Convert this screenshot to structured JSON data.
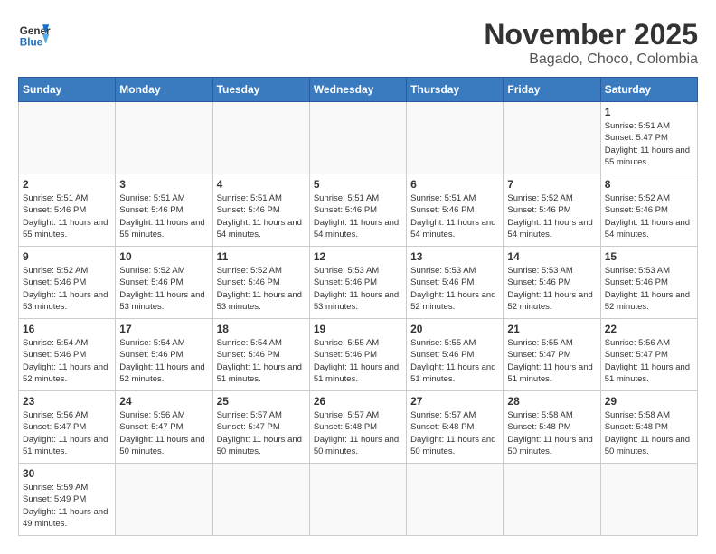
{
  "header": {
    "logo_general": "General",
    "logo_blue": "Blue",
    "month_title": "November 2025",
    "location": "Bagado, Choco, Colombia"
  },
  "weekdays": [
    "Sunday",
    "Monday",
    "Tuesday",
    "Wednesday",
    "Thursday",
    "Friday",
    "Saturday"
  ],
  "weeks": [
    [
      {
        "day": "",
        "info": ""
      },
      {
        "day": "",
        "info": ""
      },
      {
        "day": "",
        "info": ""
      },
      {
        "day": "",
        "info": ""
      },
      {
        "day": "",
        "info": ""
      },
      {
        "day": "",
        "info": ""
      },
      {
        "day": "1",
        "info": "Sunrise: 5:51 AM\nSunset: 5:47 PM\nDaylight: 11 hours and 55 minutes."
      }
    ],
    [
      {
        "day": "2",
        "info": "Sunrise: 5:51 AM\nSunset: 5:46 PM\nDaylight: 11 hours and 55 minutes."
      },
      {
        "day": "3",
        "info": "Sunrise: 5:51 AM\nSunset: 5:46 PM\nDaylight: 11 hours and 55 minutes."
      },
      {
        "day": "4",
        "info": "Sunrise: 5:51 AM\nSunset: 5:46 PM\nDaylight: 11 hours and 54 minutes."
      },
      {
        "day": "5",
        "info": "Sunrise: 5:51 AM\nSunset: 5:46 PM\nDaylight: 11 hours and 54 minutes."
      },
      {
        "day": "6",
        "info": "Sunrise: 5:51 AM\nSunset: 5:46 PM\nDaylight: 11 hours and 54 minutes."
      },
      {
        "day": "7",
        "info": "Sunrise: 5:52 AM\nSunset: 5:46 PM\nDaylight: 11 hours and 54 minutes."
      },
      {
        "day": "8",
        "info": "Sunrise: 5:52 AM\nSunset: 5:46 PM\nDaylight: 11 hours and 54 minutes."
      }
    ],
    [
      {
        "day": "9",
        "info": "Sunrise: 5:52 AM\nSunset: 5:46 PM\nDaylight: 11 hours and 53 minutes."
      },
      {
        "day": "10",
        "info": "Sunrise: 5:52 AM\nSunset: 5:46 PM\nDaylight: 11 hours and 53 minutes."
      },
      {
        "day": "11",
        "info": "Sunrise: 5:52 AM\nSunset: 5:46 PM\nDaylight: 11 hours and 53 minutes."
      },
      {
        "day": "12",
        "info": "Sunrise: 5:53 AM\nSunset: 5:46 PM\nDaylight: 11 hours and 53 minutes."
      },
      {
        "day": "13",
        "info": "Sunrise: 5:53 AM\nSunset: 5:46 PM\nDaylight: 11 hours and 52 minutes."
      },
      {
        "day": "14",
        "info": "Sunrise: 5:53 AM\nSunset: 5:46 PM\nDaylight: 11 hours and 52 minutes."
      },
      {
        "day": "15",
        "info": "Sunrise: 5:53 AM\nSunset: 5:46 PM\nDaylight: 11 hours and 52 minutes."
      }
    ],
    [
      {
        "day": "16",
        "info": "Sunrise: 5:54 AM\nSunset: 5:46 PM\nDaylight: 11 hours and 52 minutes."
      },
      {
        "day": "17",
        "info": "Sunrise: 5:54 AM\nSunset: 5:46 PM\nDaylight: 11 hours and 52 minutes."
      },
      {
        "day": "18",
        "info": "Sunrise: 5:54 AM\nSunset: 5:46 PM\nDaylight: 11 hours and 51 minutes."
      },
      {
        "day": "19",
        "info": "Sunrise: 5:55 AM\nSunset: 5:46 PM\nDaylight: 11 hours and 51 minutes."
      },
      {
        "day": "20",
        "info": "Sunrise: 5:55 AM\nSunset: 5:46 PM\nDaylight: 11 hours and 51 minutes."
      },
      {
        "day": "21",
        "info": "Sunrise: 5:55 AM\nSunset: 5:47 PM\nDaylight: 11 hours and 51 minutes."
      },
      {
        "day": "22",
        "info": "Sunrise: 5:56 AM\nSunset: 5:47 PM\nDaylight: 11 hours and 51 minutes."
      }
    ],
    [
      {
        "day": "23",
        "info": "Sunrise: 5:56 AM\nSunset: 5:47 PM\nDaylight: 11 hours and 51 minutes."
      },
      {
        "day": "24",
        "info": "Sunrise: 5:56 AM\nSunset: 5:47 PM\nDaylight: 11 hours and 50 minutes."
      },
      {
        "day": "25",
        "info": "Sunrise: 5:57 AM\nSunset: 5:47 PM\nDaylight: 11 hours and 50 minutes."
      },
      {
        "day": "26",
        "info": "Sunrise: 5:57 AM\nSunset: 5:48 PM\nDaylight: 11 hours and 50 minutes."
      },
      {
        "day": "27",
        "info": "Sunrise: 5:57 AM\nSunset: 5:48 PM\nDaylight: 11 hours and 50 minutes."
      },
      {
        "day": "28",
        "info": "Sunrise: 5:58 AM\nSunset: 5:48 PM\nDaylight: 11 hours and 50 minutes."
      },
      {
        "day": "29",
        "info": "Sunrise: 5:58 AM\nSunset: 5:48 PM\nDaylight: 11 hours and 50 minutes."
      }
    ],
    [
      {
        "day": "30",
        "info": "Sunrise: 5:59 AM\nSunset: 5:49 PM\nDaylight: 11 hours and 49 minutes."
      },
      {
        "day": "",
        "info": ""
      },
      {
        "day": "",
        "info": ""
      },
      {
        "day": "",
        "info": ""
      },
      {
        "day": "",
        "info": ""
      },
      {
        "day": "",
        "info": ""
      },
      {
        "day": "",
        "info": ""
      }
    ]
  ]
}
